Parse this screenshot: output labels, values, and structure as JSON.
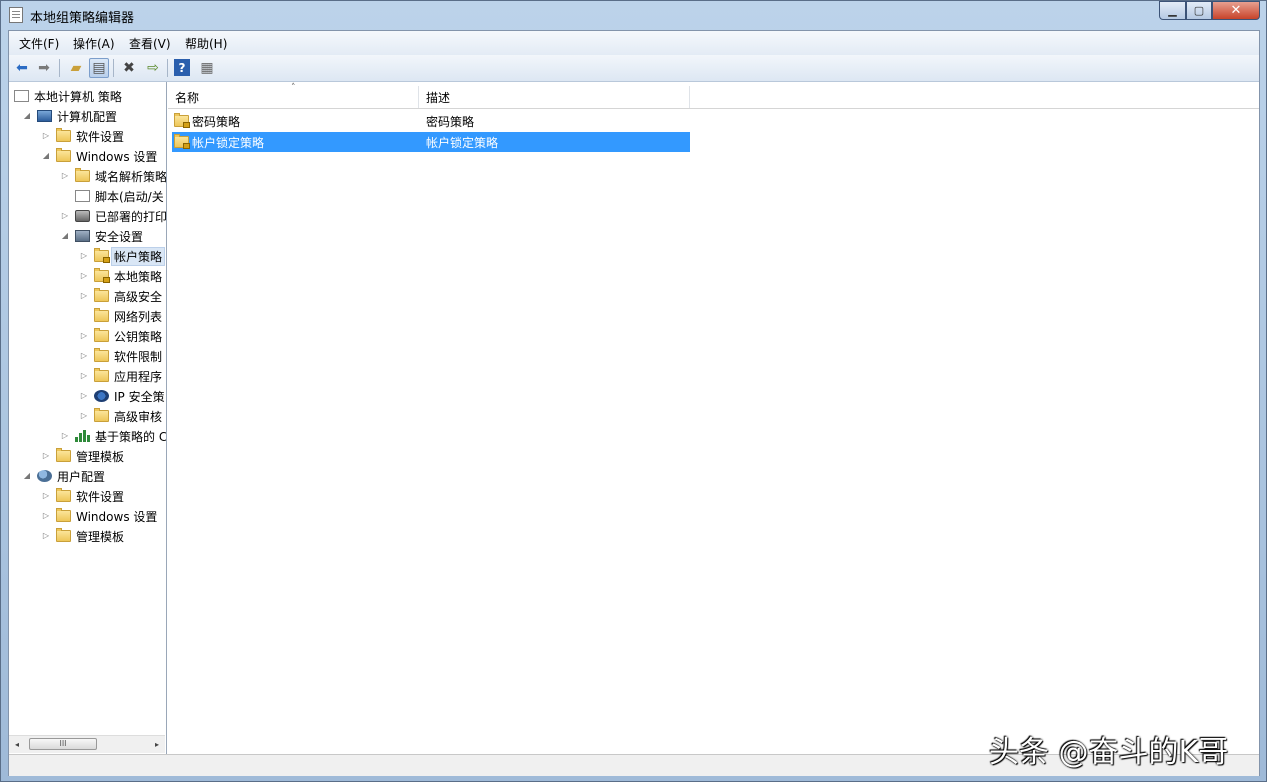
{
  "window": {
    "title": "本地组策略编辑器"
  },
  "menu": [
    "文件(F)",
    "操作(A)",
    "查看(V)",
    "帮助(H)"
  ],
  "toolbar": {
    "icons": [
      "back-arrow-icon",
      "forward-arrow-icon",
      "up-folder-icon",
      "show-hide-tree-icon",
      "delete-icon",
      "export-icon",
      "help-icon",
      "properties-icon"
    ]
  },
  "tree": [
    {
      "label": "本地计算机 策略",
      "level": 0,
      "icon": "doc",
      "expander": ""
    },
    {
      "label": "计算机配置",
      "level": 1,
      "icon": "pc",
      "expander": "◢"
    },
    {
      "label": "软件设置",
      "level": 2,
      "icon": "folder",
      "expander": "▷"
    },
    {
      "label": "Windows 设置",
      "level": 2,
      "icon": "folder",
      "expander": "◢"
    },
    {
      "label": "域名解析策略",
      "level": 3,
      "icon": "folder",
      "expander": "▷"
    },
    {
      "label": "脚本(启动/关",
      "level": 3,
      "icon": "doc",
      "expander": ""
    },
    {
      "label": "已部署的打印",
      "level": 3,
      "icon": "printer",
      "expander": "▷"
    },
    {
      "label": "安全设置",
      "level": 3,
      "icon": "shield",
      "expander": "◢"
    },
    {
      "label": "帐户策略",
      "level": 4,
      "icon": "folder-lock",
      "expander": "▷",
      "selected": true
    },
    {
      "label": "本地策略",
      "level": 4,
      "icon": "folder-lock",
      "expander": "▷"
    },
    {
      "label": "高级安全",
      "level": 4,
      "icon": "folder",
      "expander": "▷"
    },
    {
      "label": "网络列表",
      "level": 4,
      "icon": "folder",
      "expander": ""
    },
    {
      "label": "公钥策略",
      "level": 4,
      "icon": "folder",
      "expander": "▷"
    },
    {
      "label": "软件限制",
      "level": 4,
      "icon": "folder",
      "expander": "▷"
    },
    {
      "label": "应用程序",
      "level": 4,
      "icon": "folder",
      "expander": "▷"
    },
    {
      "label": "IP 安全策",
      "level": 4,
      "icon": "ip",
      "expander": "▷"
    },
    {
      "label": "高级审核",
      "level": 4,
      "icon": "folder",
      "expander": "▷"
    },
    {
      "label": "基于策略的 C",
      "level": 3,
      "icon": "chart",
      "expander": "▷"
    },
    {
      "label": "管理模板",
      "level": 2,
      "icon": "folder",
      "expander": "▷"
    },
    {
      "label": "用户配置",
      "level": 1,
      "icon": "users",
      "expander": "◢"
    },
    {
      "label": "软件设置",
      "level": 2,
      "icon": "folder",
      "expander": "▷"
    },
    {
      "label": "Windows 设置",
      "level": 2,
      "icon": "folder",
      "expander": "▷"
    },
    {
      "label": "管理模板",
      "level": 2,
      "icon": "folder",
      "expander": "▷"
    }
  ],
  "tree_scrollbar": {
    "left": "◂",
    "right": "▸",
    "thumb": "III"
  },
  "list": {
    "columns": [
      "名称",
      "描述"
    ],
    "sort_indicator": "˄",
    "rows": [
      {
        "name": "密码策略",
        "desc": "密码策略",
        "selected": false
      },
      {
        "name": "帐户锁定策略",
        "desc": "帐户锁定策略",
        "selected": true
      }
    ]
  },
  "watermark": "头条 @奋斗的K哥",
  "colors": {
    "selection": "#3399ff",
    "tree_selection": "#d9e6f5"
  }
}
